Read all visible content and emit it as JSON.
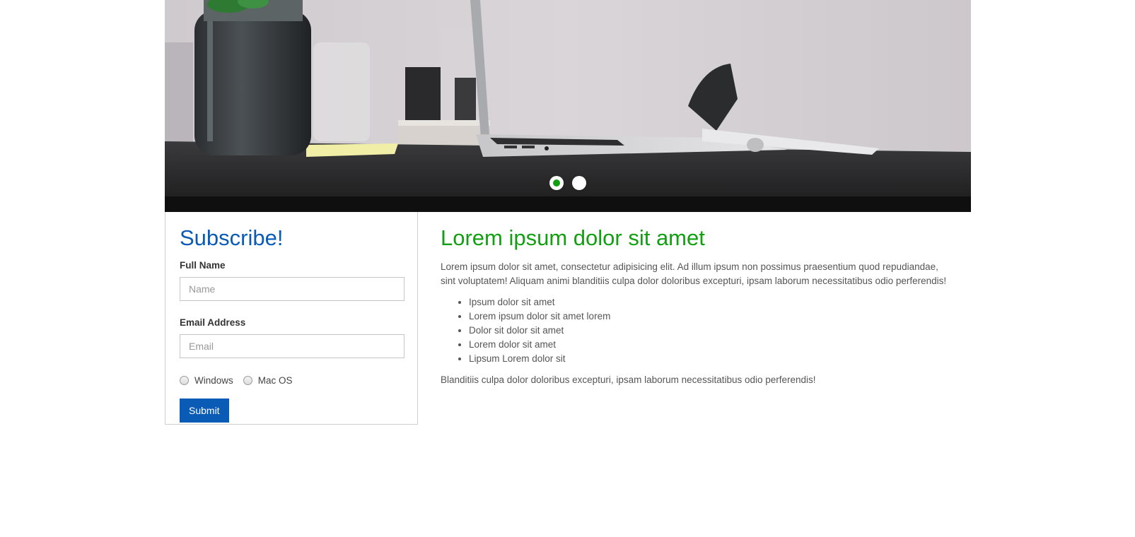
{
  "theme": {
    "accent": "#12a012",
    "heading_blue": "#0a5bb5",
    "button_blue": "#0a5bb5"
  },
  "carousel": {
    "slides": 2,
    "active_slide": 1
  },
  "subscribe": {
    "title": "Subscribe!",
    "name_label": "Full Name",
    "name_placeholder": "Name",
    "name_value": "",
    "email_label": "Email Address",
    "email_placeholder": "Email",
    "email_value": "",
    "radio_options": [
      "Windows",
      "Mac OS"
    ],
    "submit_label": "Submit"
  },
  "article": {
    "title": "Lorem ipsum dolor sit amet",
    "intro": "Lorem ipsum dolor sit amet, consectetur adipisicing elit. Ad illum ipsum non possimus praesentium quod repudiandae, sint voluptatem! Aliquam animi blanditiis culpa dolor doloribus excepturi, ipsam laborum necessitatibus odio perferendis!",
    "list": [
      "Ipsum dolor sit amet",
      "Lorem ipsum dolor sit amet lorem",
      "Dolor sit dolor sit amet",
      "Lorem dolor sit amet",
      "Lipsum Lorem dolor sit"
    ],
    "outro": "Blanditiis culpa dolor doloribus excepturi, ipsam laborum necessitatibus odio perferendis!"
  }
}
